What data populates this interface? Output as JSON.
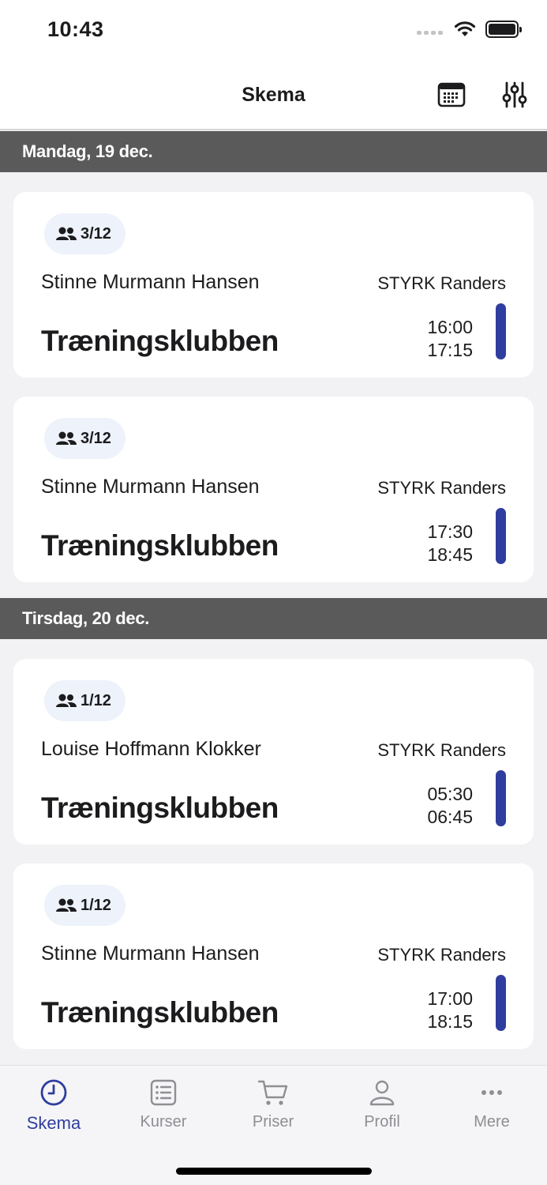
{
  "status_bar": {
    "time": "10:43"
  },
  "nav": {
    "title": "Skema",
    "calendar_icon": "calendar-icon",
    "filter_icon": "sliders-icon"
  },
  "days": [
    {
      "label": "Mandag, 19 dec.",
      "classes": [
        {
          "capacity": "3/12",
          "instructor": "Stinne Murmann Hansen",
          "location": "STYRK Randers",
          "name": "Træningsklubben",
          "start": "16:00",
          "end": "17:15"
        },
        {
          "capacity": "3/12",
          "instructor": "Stinne Murmann Hansen",
          "location": "STYRK Randers",
          "name": "Træningsklubben",
          "start": "17:30",
          "end": "18:45"
        }
      ]
    },
    {
      "label": "Tirsdag, 20 dec.",
      "classes": [
        {
          "capacity": "1/12",
          "instructor": "Louise Hoffmann Klokker",
          "location": "STYRK Randers",
          "name": "Træningsklubben",
          "start": "05:30",
          "end": "06:45"
        },
        {
          "capacity": "1/12",
          "instructor": "Stinne Murmann Hansen",
          "location": "STYRK Randers",
          "name": "Træningsklubben",
          "start": "17:00",
          "end": "18:15"
        }
      ]
    }
  ],
  "tabs": [
    {
      "label": "Skema",
      "icon": "clock-icon",
      "active": true
    },
    {
      "label": "Kurser",
      "icon": "list-icon",
      "active": false
    },
    {
      "label": "Priser",
      "icon": "cart-icon",
      "active": false
    },
    {
      "label": "Profil",
      "icon": "person-icon",
      "active": false
    },
    {
      "label": "Mere",
      "icon": "more-icon",
      "active": false
    }
  ],
  "colors": {
    "accent": "#2f3e9e",
    "day_header": "#5a5a5a",
    "badge_bg": "#edf2fb"
  }
}
